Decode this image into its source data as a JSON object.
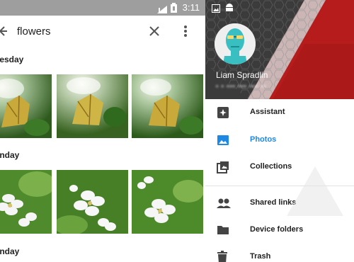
{
  "status_bar": {
    "time": "3:11"
  },
  "search": {
    "query": "flowers"
  },
  "sections": [
    {
      "label": "uesday"
    },
    {
      "label": "onday"
    },
    {
      "label": "unday"
    }
  ],
  "account": {
    "name": "Liam Spradlin",
    "email": "• •  ••• •••  •••  ••"
  },
  "nav": {
    "assistant": "Assistant",
    "photos": "Photos",
    "collections": "Collections",
    "shared_links": "Shared links",
    "device_folders": "Device folders",
    "trash": "Trash"
  },
  "colors": {
    "accent": "#1e88e5",
    "header_red": "#b71c1c",
    "header_dark": "#3a3a3a",
    "status_gray": "#9e9e9e"
  },
  "icons": {
    "status_left": [
      "image-icon",
      "android-icon"
    ],
    "status_right": [
      "signal-icon",
      "battery-icon"
    ]
  }
}
